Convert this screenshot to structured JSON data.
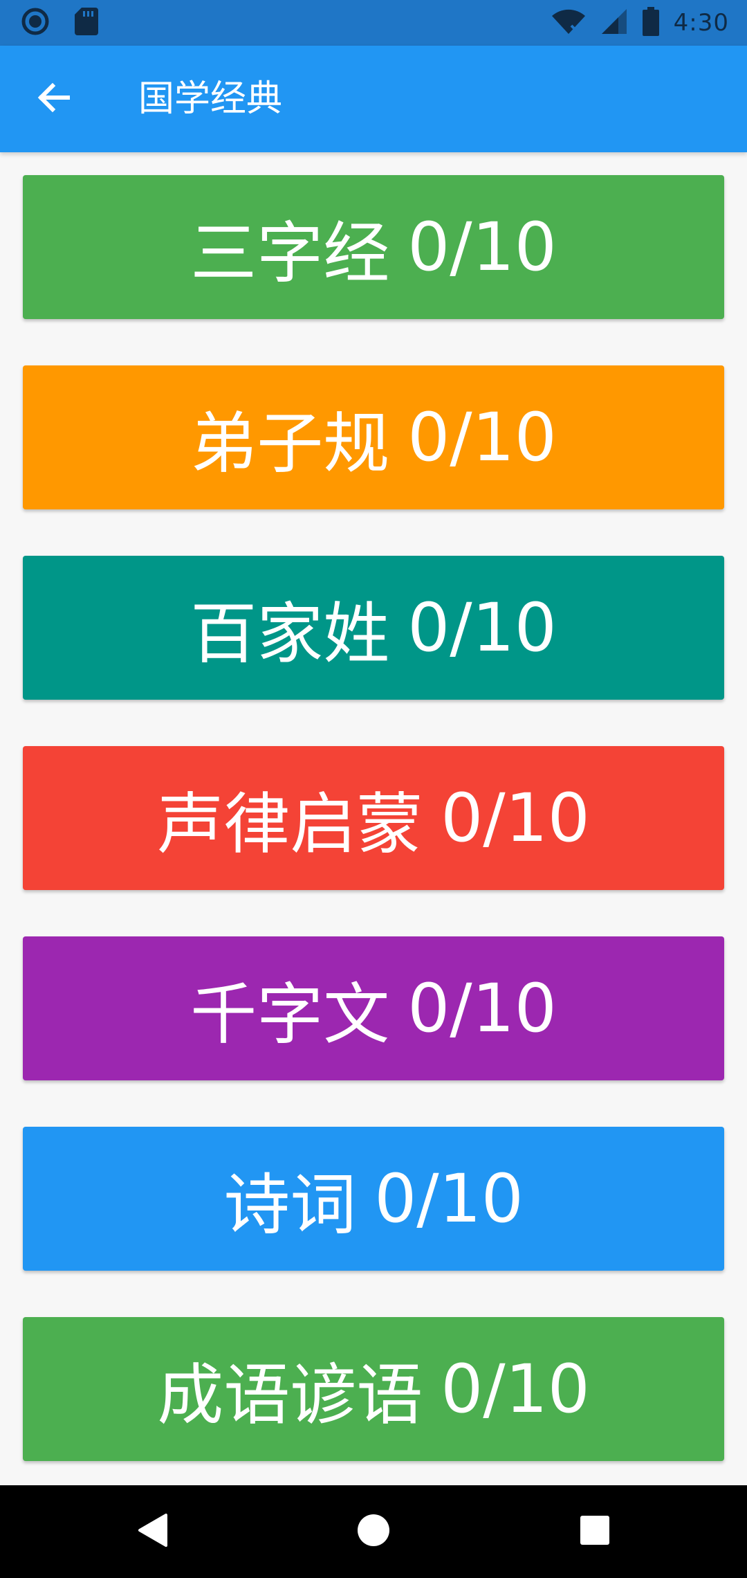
{
  "status_bar": {
    "time": "4:30",
    "icons": [
      "circle-app-icon",
      "sd-card-icon",
      "wifi-icon",
      "signal-icon",
      "battery-icon"
    ]
  },
  "app_bar": {
    "title": "国学经典",
    "back_icon": "arrow-left-icon"
  },
  "items": [
    {
      "name": "三字经",
      "count": "0/10",
      "color": "#4caf50"
    },
    {
      "name": "弟子规",
      "count": "0/10",
      "color": "#ff9800"
    },
    {
      "name": "百家姓",
      "count": "0/10",
      "color": "#009688"
    },
    {
      "name": "声律启蒙",
      "count": "0/10",
      "color": "#f44336"
    },
    {
      "name": "千字文",
      "count": "0/10",
      "color": "#9c27b0"
    },
    {
      "name": "诗词",
      "count": "0/10",
      "color": "#2196f3"
    },
    {
      "name": "成语谚语",
      "count": "0/10",
      "color": "#4caf50"
    }
  ],
  "nav_bar": {
    "icons": [
      "back-triangle-icon",
      "home-circle-icon",
      "recents-square-icon"
    ]
  }
}
